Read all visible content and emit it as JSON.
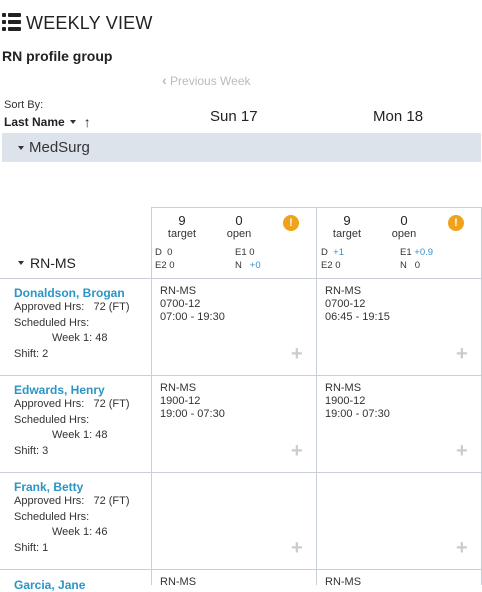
{
  "header": {
    "title": "WEEKLY VIEW",
    "group": "RN profile group",
    "prev_week": "Previous Week"
  },
  "sort": {
    "label": "Sort By:",
    "value": "Last Name"
  },
  "days": [
    "Sun 17",
    "Mon 18"
  ],
  "unit": "MedSurg",
  "role": "RN-MS",
  "summary": [
    {
      "target": "9",
      "target_label": "target",
      "open": "0",
      "open_label": "open",
      "d_label": "D",
      "d_val": "0",
      "e1_label": "E1",
      "e1_val": "0",
      "e2_label": "E2",
      "e2_val": "0",
      "n_label": "N",
      "n_val": "+0"
    },
    {
      "target": "9",
      "target_label": "target",
      "open": "0",
      "open_label": "open",
      "d_label": "D",
      "d_val": "+1",
      "e1_label": "E1",
      "e1_val": "+0.9",
      "e2_label": "E2",
      "e2_val": "0",
      "n_label": "N",
      "n_val": "0"
    }
  ],
  "employees": [
    {
      "name": "Donaldson, Brogan",
      "approved": "Approved Hrs:   72 (FT)",
      "scheduled": "Scheduled Hrs:",
      "week": "Week 1: 48",
      "shift": "Shift: 2",
      "cells": [
        {
          "role": "RN-MS",
          "code": "0700-12",
          "time": "07:00 - 19:30"
        },
        {
          "role": "RN-MS",
          "code": "0700-12",
          "time": "06:45 - 19:15"
        }
      ]
    },
    {
      "name": "Edwards, Henry",
      "approved": "Approved Hrs:   72 (FT)",
      "scheduled": "Scheduled Hrs:",
      "week": "Week 1: 48",
      "shift": "Shift: 3",
      "cells": [
        {
          "role": "RN-MS",
          "code": "1900-12",
          "time": "19:00 - 07:30"
        },
        {
          "role": "RN-MS",
          "code": "1900-12",
          "time": "19:00 - 07:30"
        }
      ]
    },
    {
      "name": "Frank, Betty",
      "approved": "Approved Hrs:   72 (FT)",
      "scheduled": "Scheduled Hrs:",
      "week": "Week 1: 46",
      "shift": "Shift: 1",
      "cells": [
        {
          "role": "",
          "code": "",
          "time": ""
        },
        {
          "role": "",
          "code": "",
          "time": ""
        }
      ]
    },
    {
      "name": "Garcia, Jane",
      "approved": "",
      "scheduled": "",
      "week": "",
      "shift": "",
      "cells": [
        {
          "role": "RN-MS",
          "code": "",
          "time": ""
        },
        {
          "role": "RN-MS",
          "code": "",
          "time": ""
        }
      ]
    }
  ],
  "icons": {
    "plus": "+",
    "warn": "!",
    "prev": "‹",
    "up": "↑"
  },
  "colors": {
    "link": "#2a95c6",
    "unit_bar": "#dde3ea",
    "warning": "#f0a21a"
  }
}
